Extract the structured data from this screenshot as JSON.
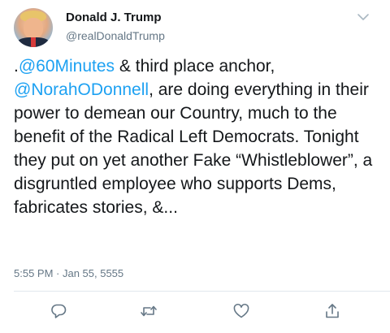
{
  "tweet": {
    "author_name": "Donald J. Trump",
    "author_handle": "@realDonaldTrump",
    "text": {
      "prefix": ".",
      "mention1": "@60Minutes",
      "part1": " & third place anchor, ",
      "mention2": "@NorahODonnell",
      "part2": ", are doing everything in their power to demean our Country, much to the benefit of the Radical Left Democrats. Tonight they put on yet another Fake “Whistleblower”, a disgruntled employee who supports Dems, fabricates stories, &..."
    },
    "timestamp": "5:55 PM · Jan 55, 5555"
  },
  "icons": {
    "caret": "chevron-down-icon",
    "reply": "reply-icon",
    "retweet": "retweet-icon",
    "like": "heart-icon",
    "share": "share-icon"
  },
  "colors": {
    "link": "#1da1f2",
    "secondary_text": "#657786",
    "icon": "#657786"
  }
}
